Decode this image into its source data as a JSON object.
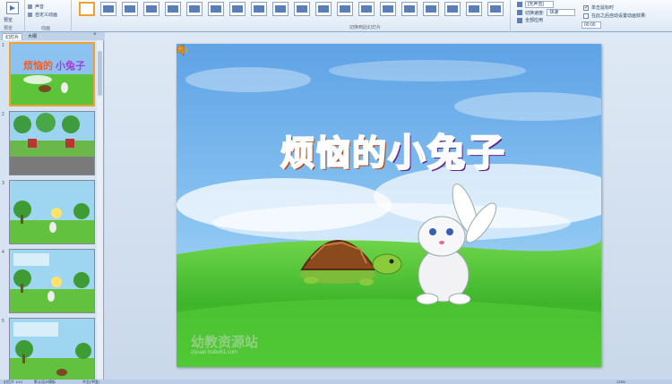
{
  "ribbon": {
    "preview_label": "预览",
    "preview_group": "预览",
    "dummy_rows": [
      "声音",
      "自定义动画"
    ],
    "dummy_group": "动画",
    "gallery_group": "切换到此幻灯片",
    "options": {
      "sound_label": "",
      "sound_value": "[无声音]",
      "speed_label": "切换速度:",
      "speed_value": "快速",
      "apply_all": "全部应用",
      "on_click": "单击鼠标时",
      "after_label": "在此之后自动设置动画效果:",
      "after_value": "00:00"
    }
  },
  "pane": {
    "tabs": [
      "幻灯片",
      "大纲"
    ],
    "close": "×",
    "slides": [
      "1",
      "2",
      "3",
      "4",
      "5"
    ]
  },
  "slide": {
    "title_part1": "烦恼的",
    "title_part2": "小兔子",
    "watermark_cn": "幼教资源站",
    "watermark_url": "ziyuan.hubu61.com"
  },
  "status": {
    "slide_info": "幻灯片 1/14",
    "theme": "默认设计模板",
    "lang": "中文(中国)",
    "zoom": "125%"
  },
  "colors": {
    "accent_orange": "#ff5a1f",
    "accent_purple": "#a63ad6",
    "selection": "#f0a030",
    "ribbon_bg": "#dde8f5"
  }
}
